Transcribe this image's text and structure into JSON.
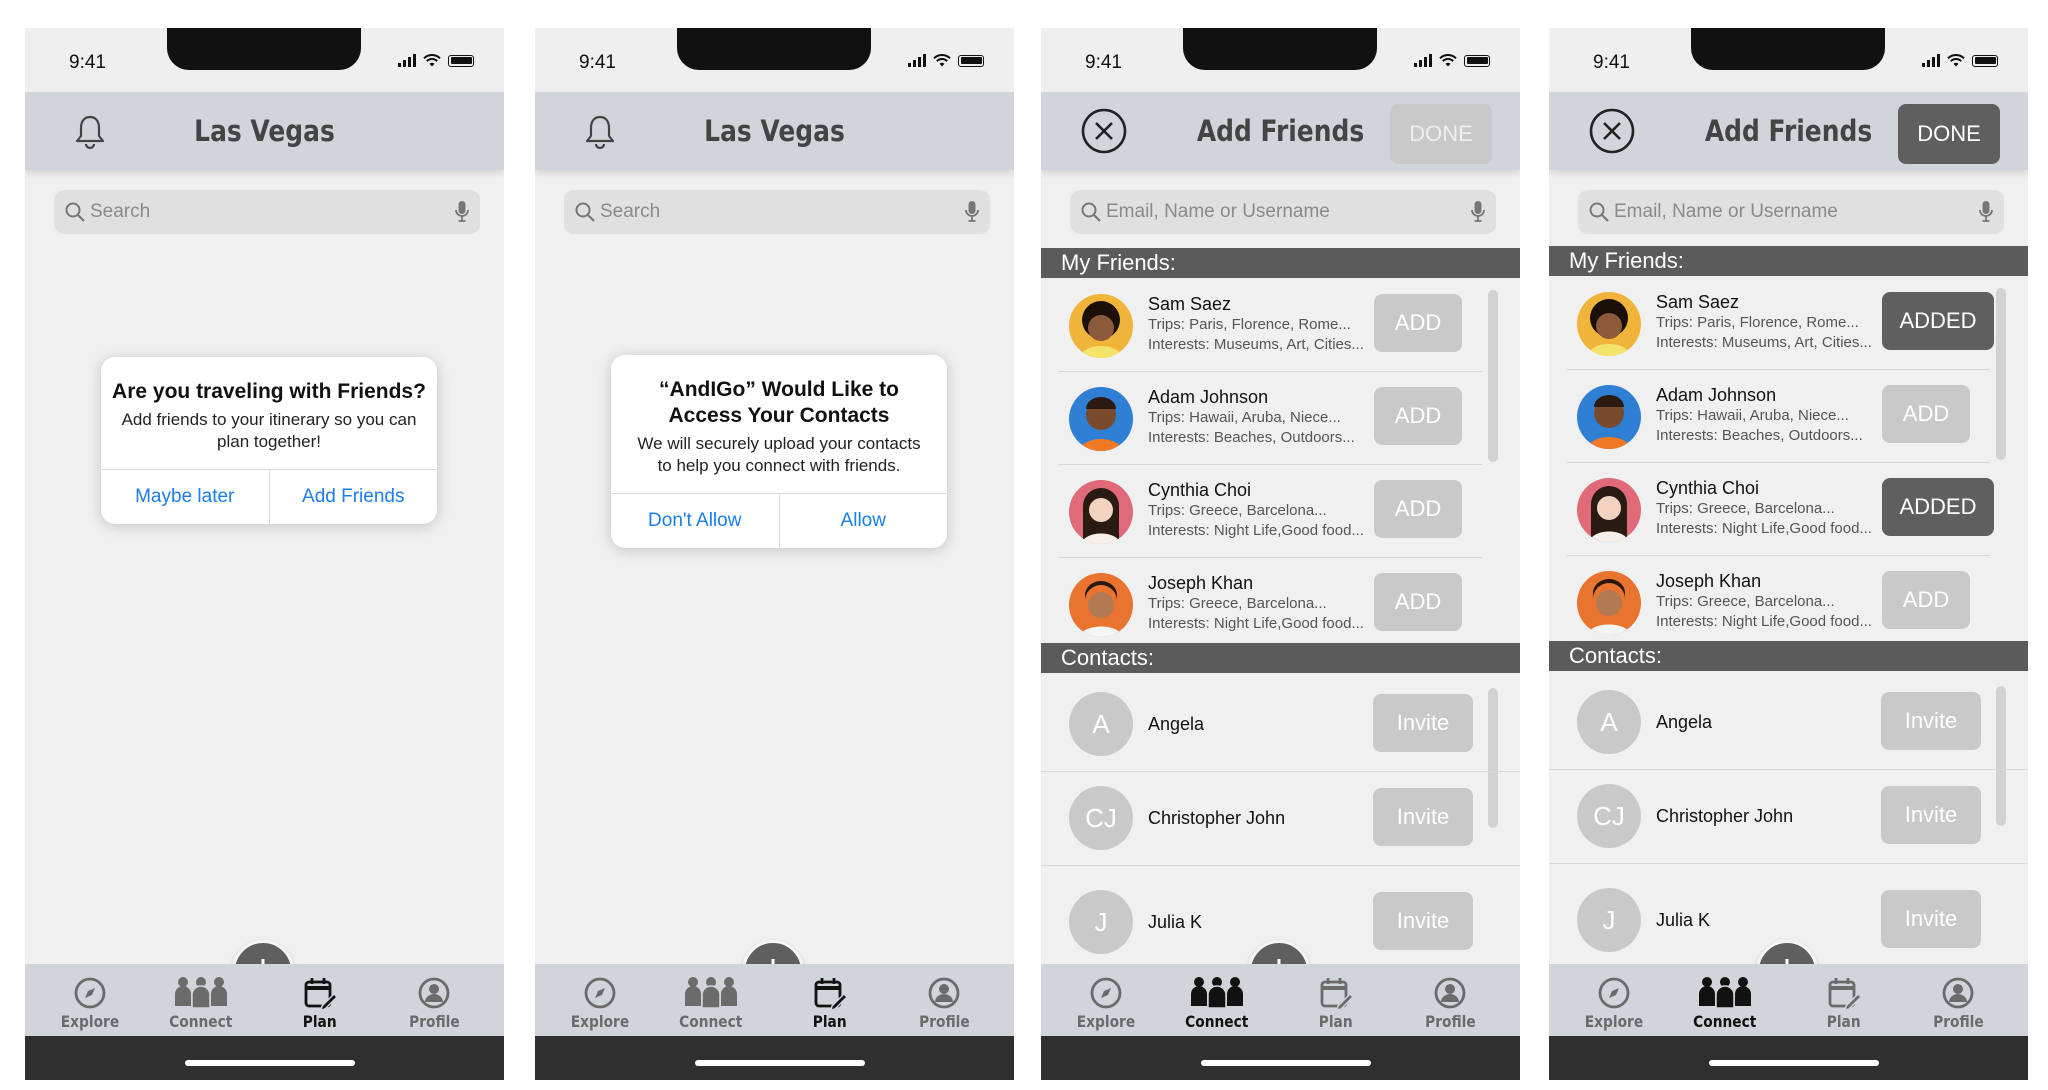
{
  "status_time": "9:41",
  "screens": [
    {
      "title": "Las Vegas",
      "search_placeholder": "Search",
      "dialog": {
        "title": "Are you traveling with Friends?",
        "message": "Add friends to your itinerary so you can plan together!",
        "left_action": "Maybe later",
        "right_action": "Add Friends"
      }
    },
    {
      "title": "Las Vegas",
      "search_placeholder": "Search",
      "dialog": {
        "title": "“AndIGo” Would Like to Access Your Contacts",
        "message": "We will securely upload your contacts to help you connect with friends.",
        "left_action": "Don't Allow",
        "right_action": "Allow"
      }
    },
    {
      "title": "Add Friends",
      "done_label": "DONE",
      "done_enabled": false,
      "search_placeholder": "Email, Name or Username",
      "friends_header": "My Friends:",
      "contacts_header": "Contacts:",
      "friends": [
        {
          "name": "Sam Saez",
          "trips": "Trips: Paris, Florence, Rome...",
          "interests": "Interests: Museums, Art, Cities...",
          "button": "ADD",
          "added": false
        },
        {
          "name": "Adam Johnson",
          "trips": "Trips: Hawaii, Aruba, Niece...",
          "interests": "Interests: Beaches, Outdoors...",
          "button": "ADD",
          "added": false
        },
        {
          "name": "Cynthia Choi",
          "trips": "Trips: Greece, Barcelona...",
          "interests": "Interests: Night Life,Good food...",
          "button": "ADD",
          "added": false
        },
        {
          "name": "Joseph Khan",
          "trips": "Trips: Greece, Barcelona...",
          "interests": "Interests: Night Life,Good food...",
          "button": "ADD",
          "added": false
        }
      ],
      "contacts": [
        {
          "initials": "A",
          "name": "Angela",
          "button": "Invite"
        },
        {
          "initials": "CJ",
          "name": "Christopher John",
          "button": "Invite"
        },
        {
          "initials": "J",
          "name": "Julia K",
          "button": "Invite"
        }
      ]
    },
    {
      "title": "Add Friends",
      "done_label": "DONE",
      "done_enabled": true,
      "search_placeholder": "Email, Name or Username",
      "friends_header": "My Friends:",
      "contacts_header": "Contacts:",
      "friends": [
        {
          "name": "Sam Saez",
          "trips": "Trips: Paris, Florence, Rome...",
          "interests": "Interests: Museums, Art, Cities...",
          "button": "ADDED",
          "added": true
        },
        {
          "name": "Adam Johnson",
          "trips": "Trips: Hawaii, Aruba, Niece...",
          "interests": "Interests: Beaches, Outdoors...",
          "button": "ADD",
          "added": false
        },
        {
          "name": "Cynthia Choi",
          "trips": "Trips: Greece, Barcelona...",
          "interests": "Interests: Night Life,Good food...",
          "button": "ADDED",
          "added": true
        },
        {
          "name": "Joseph Khan",
          "trips": "Trips: Greece, Barcelona...",
          "interests": "Interests: Night Life,Good food...",
          "button": "ADD",
          "added": false
        }
      ],
      "contacts": [
        {
          "initials": "A",
          "name": "Angela",
          "button": "Invite"
        },
        {
          "initials": "CJ",
          "name": "Christopher John",
          "button": "Invite"
        },
        {
          "initials": "J",
          "name": "Julia K",
          "button": "Invite"
        }
      ]
    }
  ],
  "tabs": {
    "explore": "Explore",
    "connect": "Connect",
    "plan": "Plan",
    "profile": "Profile"
  },
  "active_tab_per_screen": [
    "plan",
    "plan",
    "connect",
    "connect"
  ],
  "colors": {
    "header_bg": "#d1d4db",
    "dialog_action": "#1a7ee8",
    "button_disabled": "#c9c9c9",
    "button_active": "#5f5f5f",
    "section_header": "#5b5b5b"
  },
  "icons": [
    "bell-icon",
    "close-icon",
    "search-icon",
    "mic-icon",
    "compass-icon",
    "people-icon",
    "calendar-edit-icon",
    "person-icon",
    "plus-icon"
  ]
}
